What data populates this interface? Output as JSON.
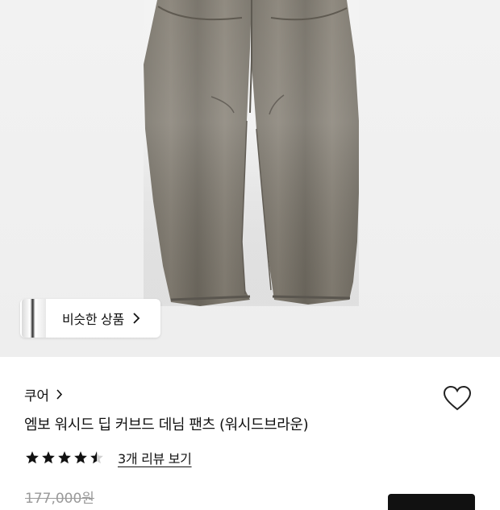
{
  "similar_products": {
    "label": "비슷한 상품"
  },
  "product": {
    "brand": "쿠어",
    "title": "엠보 워시드 딥 커브드 데님 팬츠 (워시드브라운)",
    "rating": 4.5,
    "review_link": "3개 리뷰 보기",
    "original_price": "177,000원"
  },
  "colors": {
    "denim": "#7d776c",
    "hero_bg": "#f0f0f0",
    "star": "#111111",
    "strike_price": "#9a9a9a"
  },
  "icons": [
    "chevron-right-icon",
    "heart-icon",
    "star-icon",
    "half-star-icon"
  ]
}
